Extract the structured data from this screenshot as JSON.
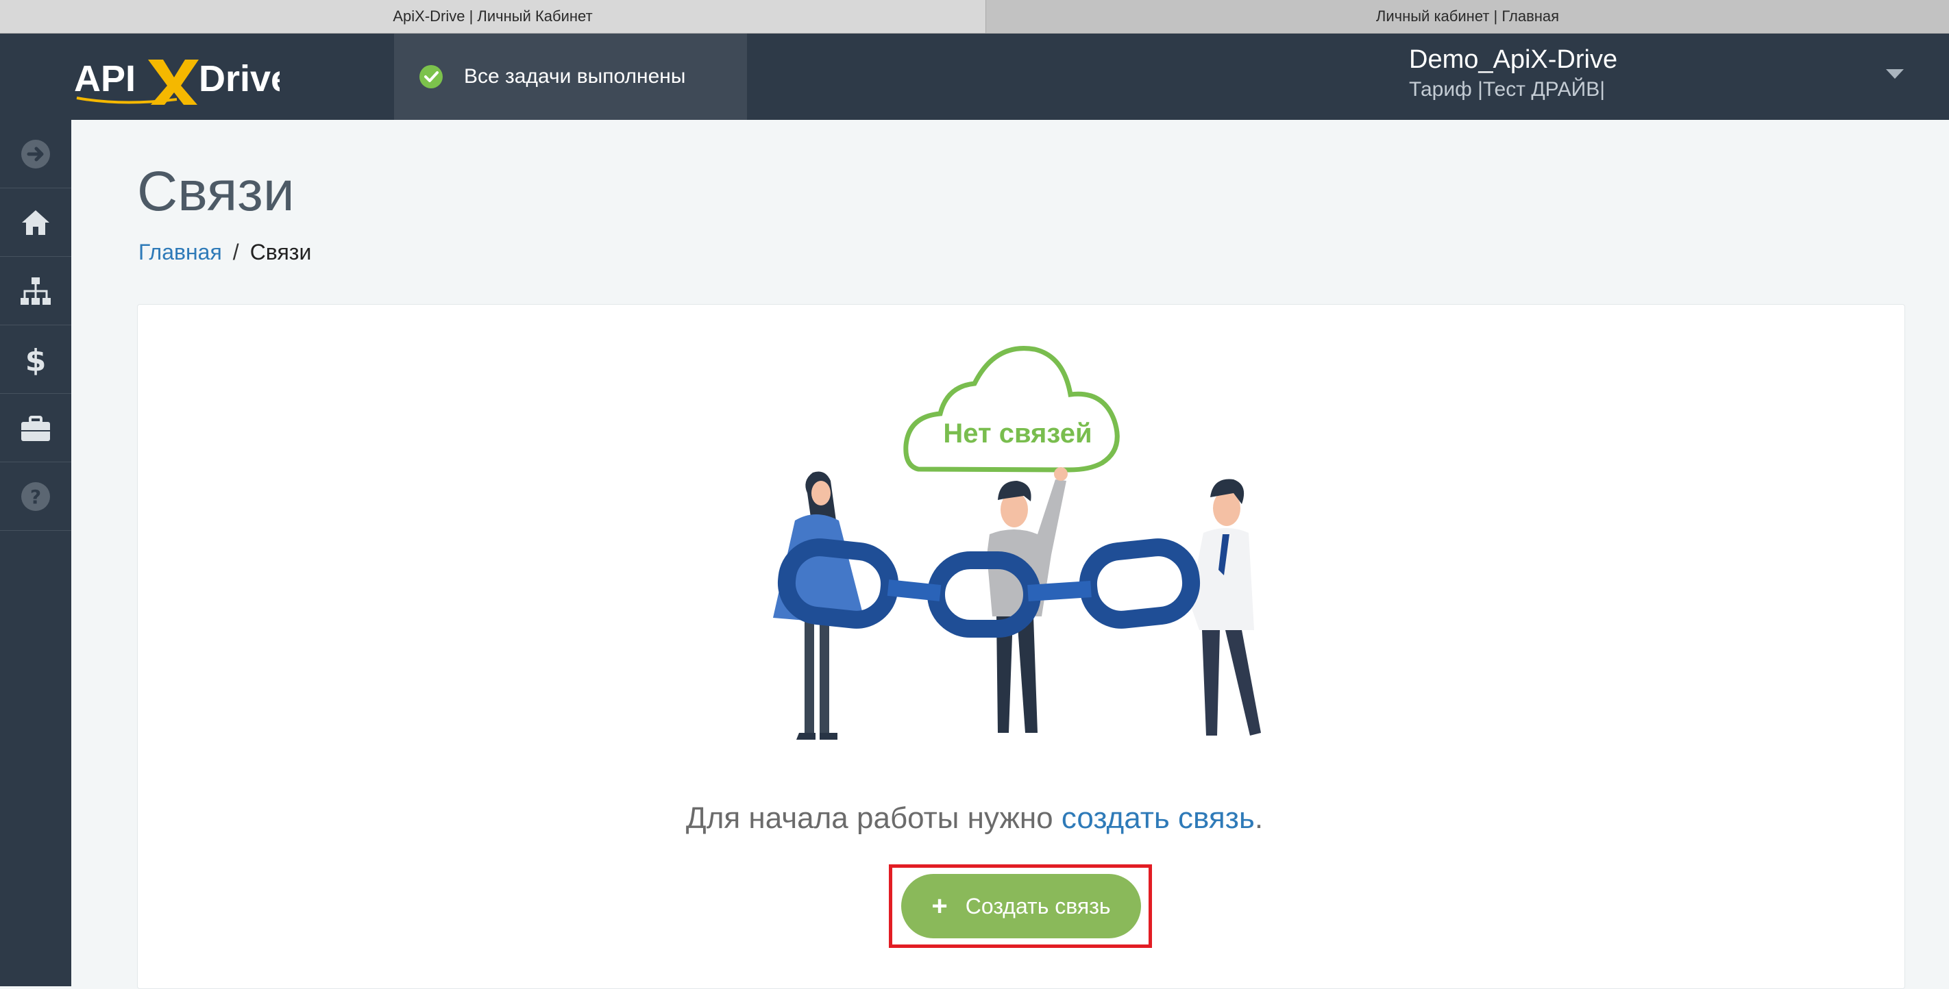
{
  "browser": {
    "tabs": [
      {
        "label": "ApiX-Drive | Личный Кабинет"
      },
      {
        "label": "Личный кабинет | Главная"
      }
    ]
  },
  "header": {
    "logo_text": "APIXDrive",
    "status_text": "Все задачи выполнены",
    "user_name": "Demo_ApiX-Drive",
    "plan_text": "Тариф |Тест ДРАЙВ|"
  },
  "sidebar": {
    "items": [
      {
        "icon": "arrow-right-circle-icon"
      },
      {
        "icon": "home-icon"
      },
      {
        "icon": "sitemap-icon"
      },
      {
        "icon": "dollar-icon"
      },
      {
        "icon": "briefcase-icon"
      },
      {
        "icon": "help-circle-icon"
      }
    ]
  },
  "page": {
    "title": "Связи",
    "breadcrumb": {
      "home": "Главная",
      "separator": "/",
      "current": "Связи"
    }
  },
  "empty_state": {
    "cloud_label": "Нет связей",
    "text_before": "Для начала работы нужно",
    "link_text": "создать связь",
    "text_after": ".",
    "button_label": "Создать связь"
  },
  "colors": {
    "header_bg": "#2e3a48",
    "accent_green": "#8ab95a",
    "link_blue": "#2e7ab8",
    "highlight_red": "#e21d24",
    "chain_blue": "#1f4e96"
  }
}
